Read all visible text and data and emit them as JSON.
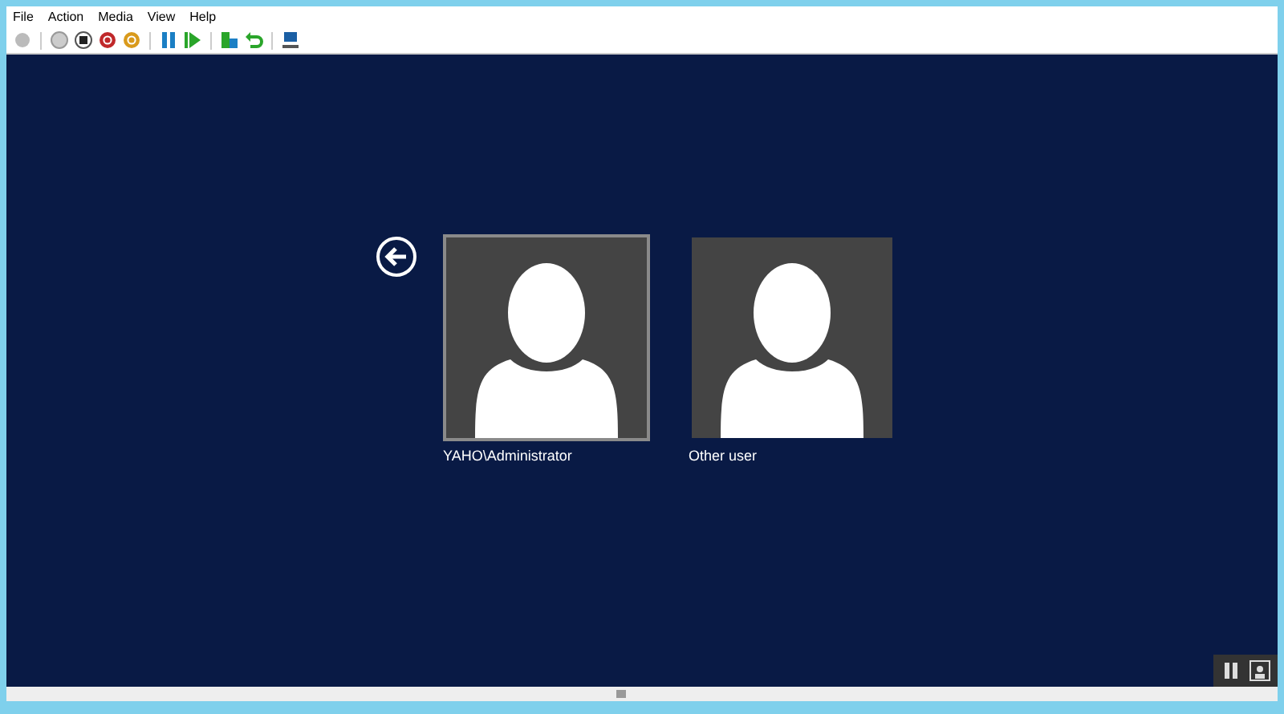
{
  "menu": [
    "File",
    "Action",
    "Media",
    "View",
    "Help"
  ],
  "users": [
    {
      "name": "YAHO\\Administrator",
      "selected": true
    },
    {
      "name": "Other user",
      "selected": false
    }
  ]
}
